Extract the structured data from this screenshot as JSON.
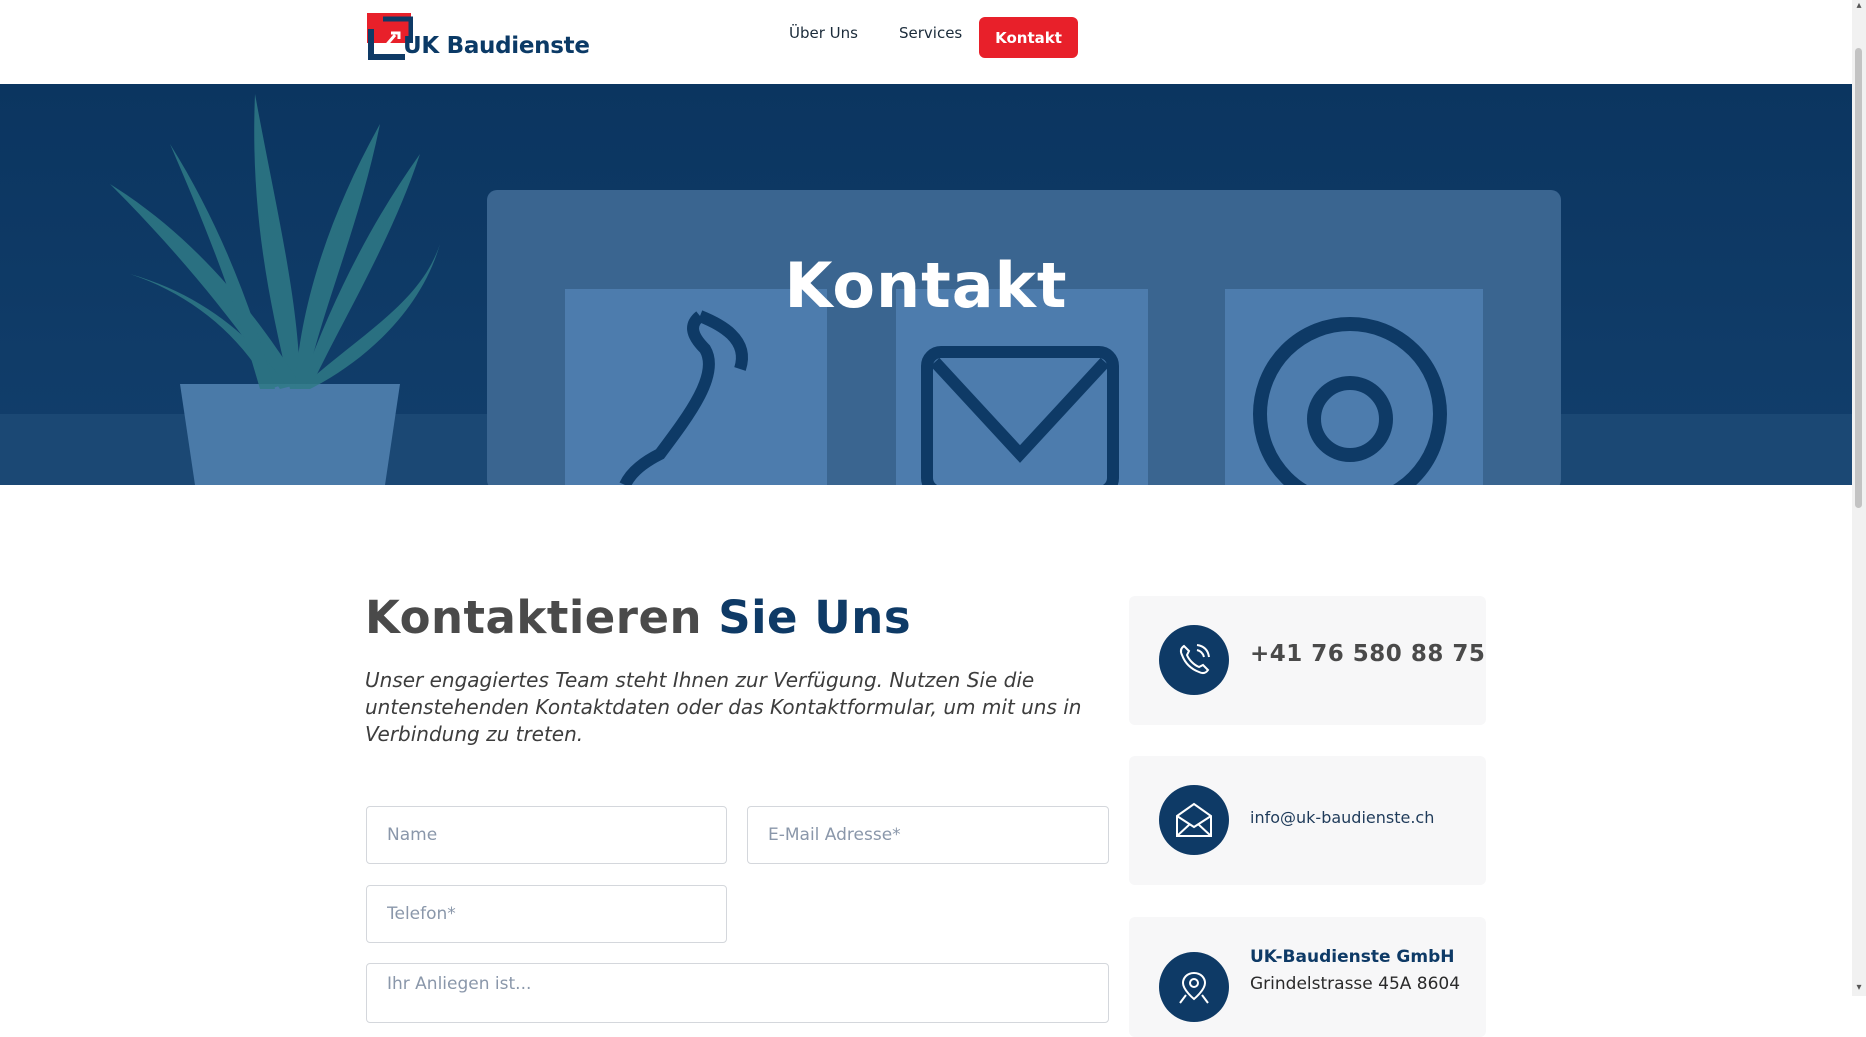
{
  "brand": {
    "name": "UK Baudienste",
    "primary_color": "#0e3a66",
    "accent_color": "#e8202a"
  },
  "nav": {
    "about": "Über Uns",
    "services": "Services",
    "contact": "Kontakt"
  },
  "hero": {
    "title": "Kontakt"
  },
  "content": {
    "heading_part1": "Kontaktieren ",
    "heading_part2": "Sie Uns",
    "intro": "Unser engagiertes Team steht Ihnen zur Verfügung. Nutzen Sie die untenstehenden Kontaktdaten oder das Kontaktformular, um mit uns in Verbindung zu treten."
  },
  "form": {
    "name_placeholder": "Name",
    "email_placeholder": "E-Mail Adresse*",
    "phone_placeholder": "Telefon*",
    "message_placeholder": "Ihr Anliegen ist..."
  },
  "contact": {
    "phone": "+41 76 580 88 75",
    "email": "info@uk-baudienste.ch",
    "company": "UK-Baudienste GmbH",
    "street": "Grindelstrasse 45A 8604"
  },
  "icons": {
    "phone": "phone-icon",
    "mail": "envelope-icon",
    "address": "map-pin-icon"
  }
}
